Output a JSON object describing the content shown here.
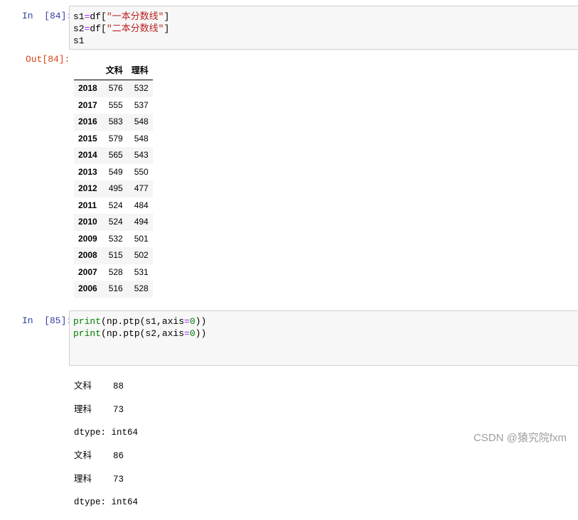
{
  "cell84": {
    "in_prompt": "In  [84]:",
    "out_prompt": "Out[84]:",
    "code": [
      {
        "a": "s1",
        "op": "=",
        "b": "df[",
        "str": "\"一本分数线\"",
        "c": "]"
      },
      {
        "a": "s2",
        "op": "=",
        "b": "df[",
        "str": "\"二本分数线\"",
        "c": "]"
      },
      {
        "a": "s1",
        "op": "",
        "b": "",
        "str": "",
        "c": ""
      }
    ],
    "table": {
      "columns": [
        "",
        "文科",
        "理科"
      ],
      "rows": [
        [
          "2018",
          "576",
          "532"
        ],
        [
          "2017",
          "555",
          "537"
        ],
        [
          "2016",
          "583",
          "548"
        ],
        [
          "2015",
          "579",
          "548"
        ],
        [
          "2014",
          "565",
          "543"
        ],
        [
          "2013",
          "549",
          "550"
        ],
        [
          "2012",
          "495",
          "477"
        ],
        [
          "2011",
          "524",
          "484"
        ],
        [
          "2010",
          "524",
          "494"
        ],
        [
          "2009",
          "532",
          "501"
        ],
        [
          "2008",
          "515",
          "502"
        ],
        [
          "2007",
          "528",
          "531"
        ],
        [
          "2006",
          "516",
          "528"
        ]
      ]
    }
  },
  "cell85": {
    "in_prompt": "In  [85]:",
    "code": [
      {
        "fn": "print",
        "pre": "(np.ptp(s1,axis",
        "op": "=",
        "num": "0",
        "post": "))"
      },
      {
        "fn": "print",
        "pre": "(np.ptp(s2,axis",
        "op": "=",
        "num": "0",
        "post": "))"
      }
    ],
    "output": [
      "文科    88",
      "理科    73",
      "dtype: int64",
      "文科    86",
      "理科    73",
      "dtype: int64"
    ]
  },
  "watermark": "CSDN @猿究院fxm"
}
